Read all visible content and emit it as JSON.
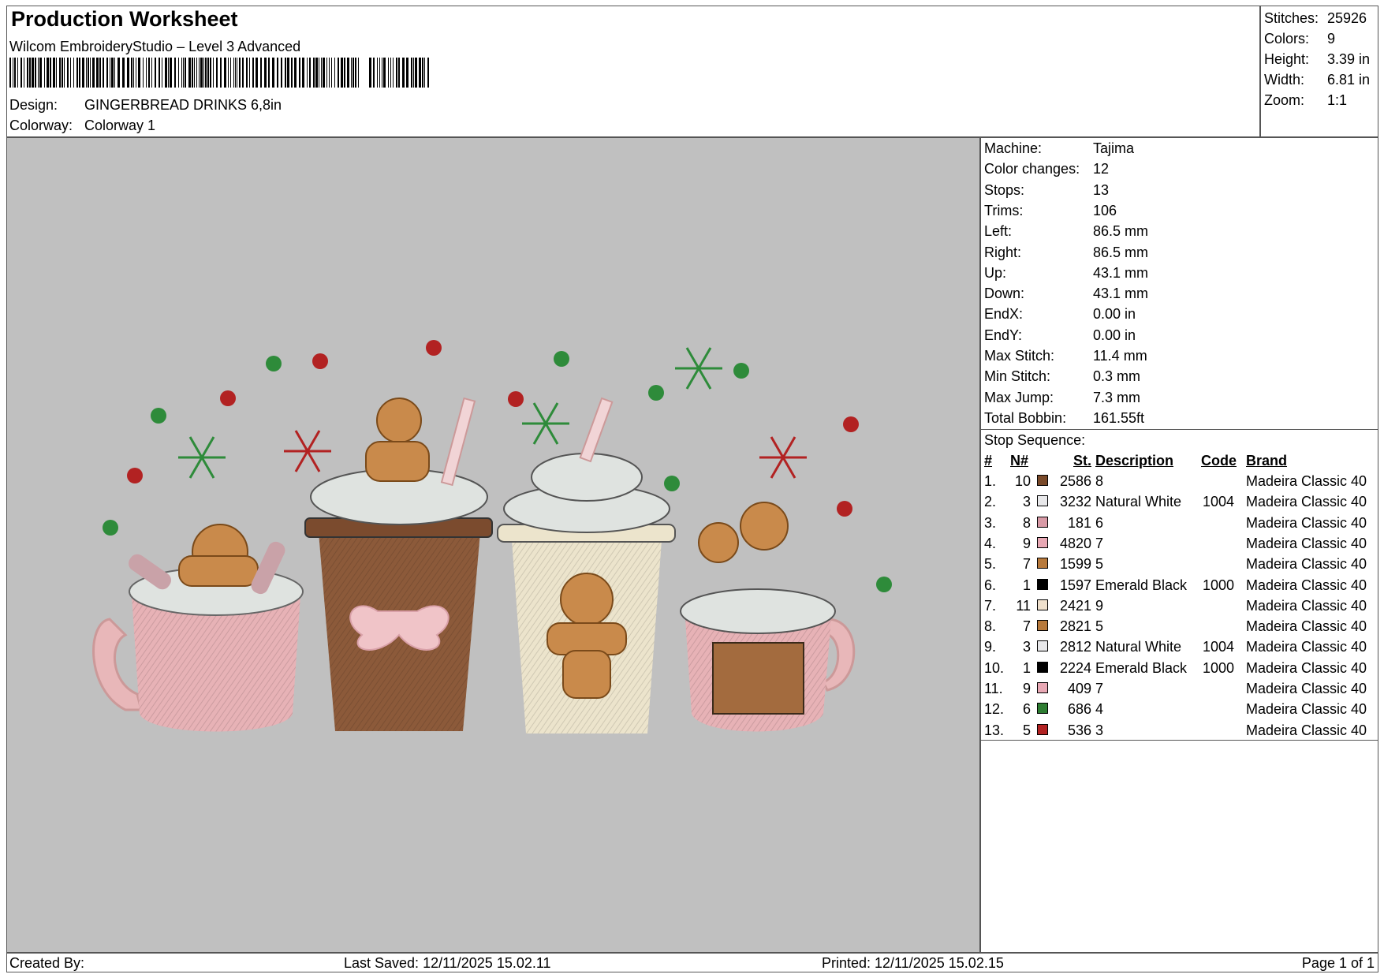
{
  "header": {
    "title": "Production Worksheet",
    "software": "Wilcom EmbroideryStudio – Level 3 Advanced",
    "design_label": "Design:",
    "design_value": "GINGERBREAD DRINKS 6,8in",
    "colorway_label": "Colorway:",
    "colorway_value": "Colorway 1"
  },
  "stats": [
    {
      "label": "Stitches:",
      "value": "25926"
    },
    {
      "label": "Colors:",
      "value": "9"
    },
    {
      "label": "Height:",
      "value": "3.39 in"
    },
    {
      "label": "Width:",
      "value": "6.81 in"
    },
    {
      "label": "Zoom:",
      "value": "1:1"
    }
  ],
  "machine_info": [
    {
      "label": "Machine:",
      "value": "Tajima"
    },
    {
      "label": "Color changes:",
      "value": "12"
    },
    {
      "label": "Stops:",
      "value": "13"
    },
    {
      "label": "Trims:",
      "value": "106"
    },
    {
      "label": "Left:",
      "value": "86.5 mm"
    },
    {
      "label": "Right:",
      "value": "86.5 mm"
    },
    {
      "label": "Up:",
      "value": "43.1 mm"
    },
    {
      "label": "Down:",
      "value": "43.1 mm"
    },
    {
      "label": "EndX:",
      "value": "0.00 in"
    },
    {
      "label": "EndY:",
      "value": "0.00 in"
    },
    {
      "label": "Max Stitch:",
      "value": "11.4 mm"
    },
    {
      "label": "Min Stitch:",
      "value": "0.3 mm"
    },
    {
      "label": "Max Jump:",
      "value": "7.3 mm"
    },
    {
      "label": "Total Bobbin:",
      "value": "161.55ft"
    }
  ],
  "stop_sequence": {
    "title": "Stop Sequence:",
    "headers": {
      "num": "#",
      "n": "N#",
      "st": "St.",
      "description": "Description",
      "code": "Code",
      "brand": "Brand"
    },
    "rows": [
      {
        "num": "1.",
        "n": "10",
        "color": "#7a4a2a",
        "st": "2586",
        "description": "8",
        "code": "",
        "brand": "Madeira Classic 40"
      },
      {
        "num": "2.",
        "n": "3",
        "color": "#e8e8ea",
        "st": "3232",
        "description": "Natural White",
        "code": "1004",
        "brand": "Madeira Classic 40"
      },
      {
        "num": "3.",
        "n": "8",
        "color": "#d89aa6",
        "st": "181",
        "description": "6",
        "code": "",
        "brand": "Madeira Classic 40"
      },
      {
        "num": "4.",
        "n": "9",
        "color": "#e8a8b4",
        "st": "4820",
        "description": "7",
        "code": "",
        "brand": "Madeira Classic 40"
      },
      {
        "num": "5.",
        "n": "7",
        "color": "#b87a3c",
        "st": "1599",
        "description": "5",
        "code": "",
        "brand": "Madeira Classic 40"
      },
      {
        "num": "6.",
        "n": "1",
        "color": "#000000",
        "st": "1597",
        "description": "Emerald Black",
        "code": "1000",
        "brand": "Madeira Classic 40"
      },
      {
        "num": "7.",
        "n": "11",
        "color": "#efe0cc",
        "st": "2421",
        "description": "9",
        "code": "",
        "brand": "Madeira Classic 40"
      },
      {
        "num": "8.",
        "n": "7",
        "color": "#b87a3c",
        "st": "2821",
        "description": "5",
        "code": "",
        "brand": "Madeira Classic 40"
      },
      {
        "num": "9.",
        "n": "3",
        "color": "#e8e8ea",
        "st": "2812",
        "description": "Natural White",
        "code": "1004",
        "brand": "Madeira Classic 40"
      },
      {
        "num": "10.",
        "n": "1",
        "color": "#000000",
        "st": "2224",
        "description": "Emerald Black",
        "code": "1000",
        "brand": "Madeira Classic 40"
      },
      {
        "num": "11.",
        "n": "9",
        "color": "#e8a8b4",
        "st": "409",
        "description": "7",
        "code": "",
        "brand": "Madeira Classic 40"
      },
      {
        "num": "12.",
        "n": "6",
        "color": "#2e7d32",
        "st": "686",
        "description": "4",
        "code": "",
        "brand": "Madeira Classic 40"
      },
      {
        "num": "13.",
        "n": "5",
        "color": "#b22222",
        "st": "536",
        "description": "3",
        "code": "",
        "brand": "Madeira Classic 40"
      }
    ]
  },
  "footer": {
    "created_by": "Created By:",
    "last_saved": "Last Saved: 12/11/2025 15.02.11",
    "printed": "Printed: 12/11/2025 15.02.15",
    "page": "Page 1 of 1"
  }
}
